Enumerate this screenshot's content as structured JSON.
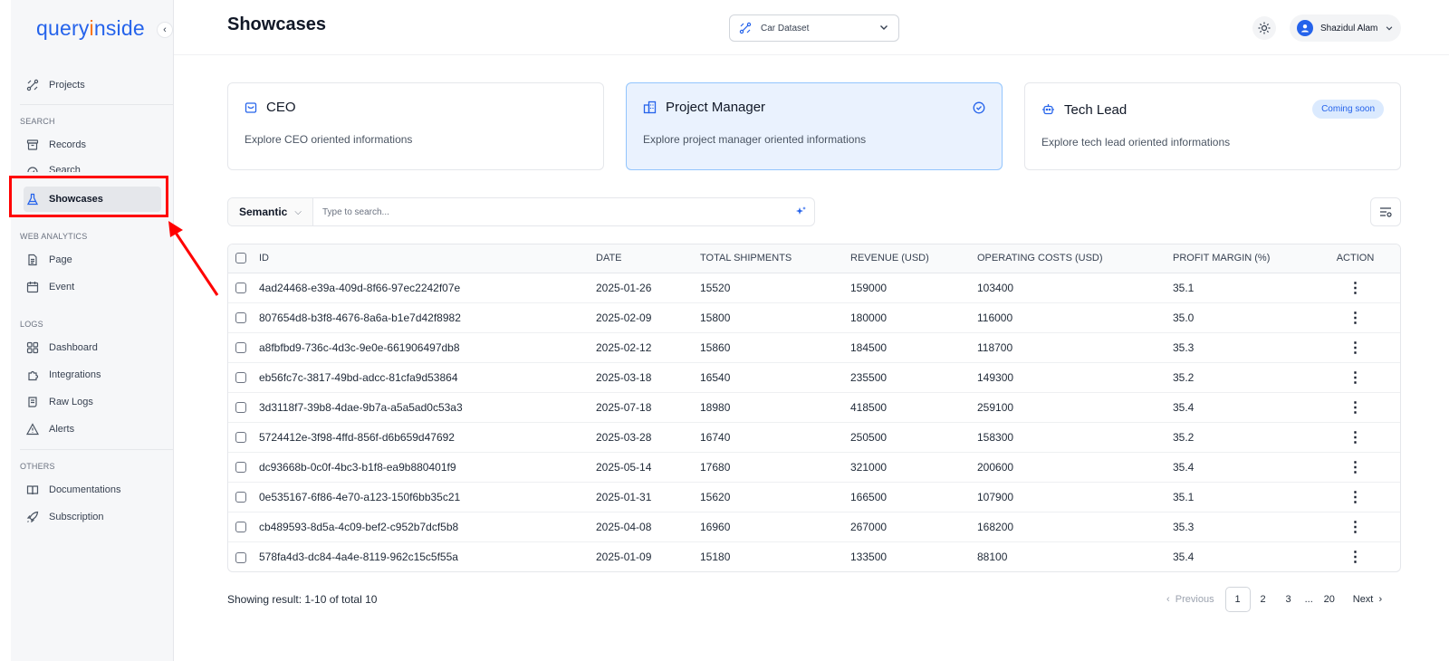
{
  "brand": {
    "name_start": "query",
    "name_dot": "i",
    "name_end": "nside"
  },
  "sidebar": {
    "projects_label": "Projects",
    "section_search": "SEARCH",
    "records_label": "Records",
    "search_label": "Search",
    "showcases_label": "Showcases",
    "section_web": "WEB ANALYTICS",
    "page_label": "Page",
    "event_label": "Event",
    "section_logs": "LOGS",
    "dashboard_label": "Dashboard",
    "integrations_label": "Integrations",
    "rawlogs_label": "Raw Logs",
    "alerts_label": "Alerts",
    "section_others": "OTHERS",
    "docs_label": "Documentations",
    "subscription_label": "Subscription"
  },
  "header": {
    "title": "Showcases",
    "dataset": "Car Dataset",
    "user_name": "Shazidul Alam"
  },
  "cards": [
    {
      "title": "CEO",
      "desc": "Explore CEO oriented informations"
    },
    {
      "title": "Project Manager",
      "desc": "Explore project manager oriented informations"
    },
    {
      "title": "Tech Lead",
      "desc": "Explore tech lead oriented informations",
      "badge": "Coming soon"
    }
  ],
  "search": {
    "mode": "Semantic",
    "placeholder": "Type to search..."
  },
  "table": {
    "headers": [
      "ID",
      "DATE",
      "TOTAL SHIPMENTS",
      "REVENUE (USD)",
      "OPERATING COSTS (USD)",
      "PROFIT MARGIN (%)",
      "ACTION"
    ],
    "rows": [
      [
        "4ad24468-e39a-409d-8f66-97ec2242f07e",
        "2025-01-26",
        "15520",
        "159000",
        "103400",
        "35.1"
      ],
      [
        "807654d8-b3f8-4676-8a6a-b1e7d42f8982",
        "2025-02-09",
        "15800",
        "180000",
        "116000",
        "35.0"
      ],
      [
        "a8fbfbd9-736c-4d3c-9e0e-661906497db8",
        "2025-02-12",
        "15860",
        "184500",
        "118700",
        "35.3"
      ],
      [
        "eb56fc7c-3817-49bd-adcc-81cfa9d53864",
        "2025-03-18",
        "16540",
        "235500",
        "149300",
        "35.2"
      ],
      [
        "3d3118f7-39b8-4dae-9b7a-a5a5ad0c53a3",
        "2025-07-18",
        "18980",
        "418500",
        "259100",
        "35.4"
      ],
      [
        "5724412e-3f98-4ffd-856f-d6b659d47692",
        "2025-03-28",
        "16740",
        "250500",
        "158300",
        "35.2"
      ],
      [
        "dc93668b-0c0f-4bc3-b1f8-ea9b880401f9",
        "2025-05-14",
        "17680",
        "321000",
        "200600",
        "35.4"
      ],
      [
        "0e535167-6f86-4e70-a123-150f6bb35c21",
        "2025-01-31",
        "15620",
        "166500",
        "107900",
        "35.1"
      ],
      [
        "cb489593-8d5a-4c09-bef2-c952b7dcf5b8",
        "2025-04-08",
        "16960",
        "267000",
        "168200",
        "35.3"
      ],
      [
        "578fa4d3-dc84-4a4e-8119-962c15c5f55a",
        "2025-01-09",
        "15180",
        "133500",
        "88100",
        "35.4"
      ]
    ],
    "action_glyph": "⋮"
  },
  "footer": {
    "showing": "Showing result: 1-10 of total 10",
    "prev": "Previous",
    "pages": [
      "1",
      "2",
      "3"
    ],
    "ellipsis": "...",
    "last_page": "20",
    "next": "Next"
  },
  "colors": {
    "accent": "#2563eb",
    "highlight": "#ff0000",
    "card_selected_bg": "#eaf2fe"
  },
  "icons": {
    "sidebar": [
      "projects-icon",
      "records-icon",
      "search-icon",
      "flask-icon",
      "page-icon",
      "calendar-icon",
      "dashboard-icon",
      "integrations-icon",
      "raw-logs-icon",
      "alert-icon",
      "book-icon",
      "rocket-icon"
    ],
    "cards": [
      "ceo-icon",
      "project-manager-icon",
      "tech-lead-icon"
    ]
  }
}
